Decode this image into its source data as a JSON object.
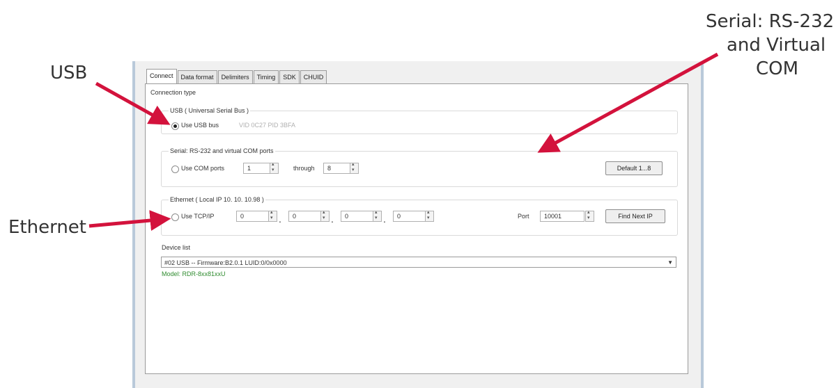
{
  "annotations": {
    "usb": "USB",
    "ethernet": "Ethernet",
    "serial_line1": "Serial: RS-232",
    "serial_line2": "and Virtual",
    "serial_line3": "COM"
  },
  "colors": {
    "arrow": "#d3123c",
    "window_border": "#b9c9da",
    "model_text": "#2e8b2e"
  },
  "tabs": [
    "Connect",
    "Data format",
    "Delimiters",
    "Timing",
    "SDK",
    "CHUID"
  ],
  "active_tab": "Connect",
  "connection_type_label": "Connection type",
  "usb": {
    "group_label": "USB ( Universal Serial Bus )",
    "radio_label": "Use USB bus",
    "selected": true,
    "vid_pid": "VID 0C27 PID 3BFA"
  },
  "serial": {
    "group_label": "Serial: RS-232 and virtual COM ports",
    "radio_label": "Use COM ports",
    "from": "1",
    "through_label": "through",
    "to": "8",
    "default_button": "Default 1...8"
  },
  "ethernet": {
    "group_label": "Ethernet ( Local IP 10. 10. 10.98 )",
    "radio_label": "Use TCP/IP",
    "ip": [
      "0",
      "0",
      "0",
      "0"
    ],
    "dot": ".",
    "port_label": "Port",
    "port_value": "10001",
    "find_button": "Find Next IP"
  },
  "device_list": {
    "label": "Device list",
    "selected": "#02 USB -- Firmware:B2.0.1 LUID:0/0x0000",
    "model": "Model: RDR-8xx81xxU"
  }
}
